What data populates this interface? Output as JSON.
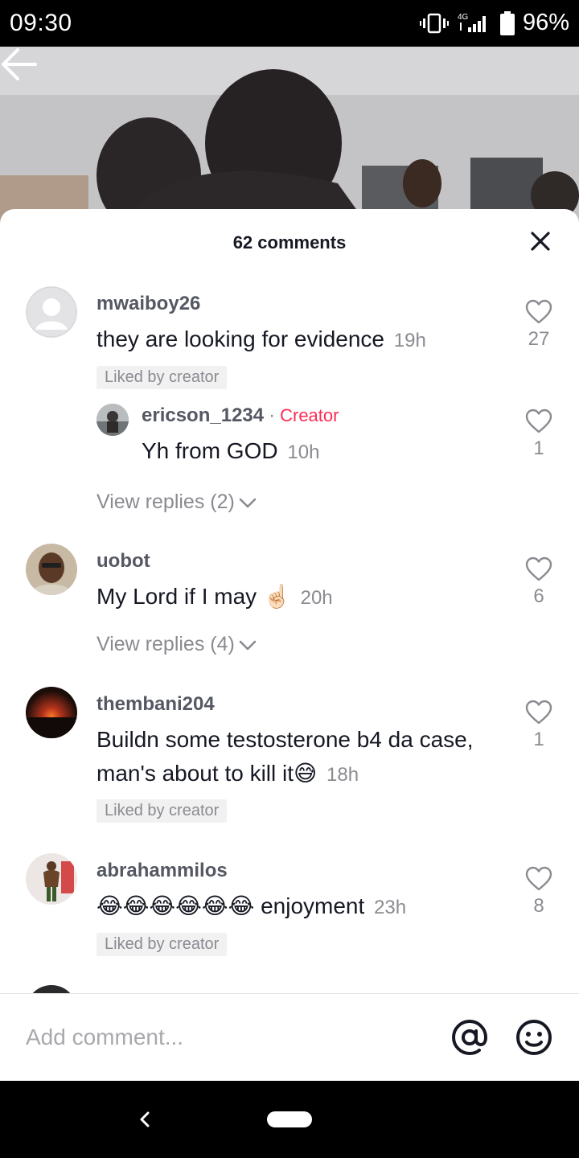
{
  "status_bar": {
    "time": "09:30",
    "network": "4G",
    "battery": "96%"
  },
  "sheet": {
    "title": "62 comments"
  },
  "comments": [
    {
      "username": "mwaiboy26",
      "text": "they are looking for evidence",
      "time": "19h",
      "likes": "27",
      "liked_by_creator": "Liked by creator"
    },
    {
      "username": "ericson_1234",
      "badge": "Creator",
      "text": "Yh from GOD",
      "time": "10h",
      "likes": "1"
    },
    {
      "view_replies": "View replies (2)"
    },
    {
      "username": "uobot",
      "text": "My Lord if I may",
      "emoji": "☝🏻",
      "time": "20h",
      "likes": "6",
      "view_replies": "View replies (4)"
    },
    {
      "username": "thembani204",
      "text_line1": "Buildn some testosterone b4 da case,",
      "text_line2": "man's about to kill it",
      "emoji": "😅",
      "time": "18h",
      "likes": "1",
      "liked_by_creator": "Liked by creator"
    },
    {
      "username": "abrahammilos",
      "emoji": "😂😂😂😂😂😂",
      "text": "enjoyment",
      "time": "23h",
      "likes": "8",
      "liked_by_creator": "Liked by creator"
    }
  ],
  "input": {
    "placeholder": "Add comment..."
  },
  "icons": {
    "back": "back-arrow-icon",
    "close": "close-icon",
    "heart": "heart-outline-icon",
    "chevron": "chevron-down-icon",
    "at": "at-mention-icon",
    "emoji": "emoji-icon"
  },
  "colors": {
    "creator": "#fe2c55",
    "text": "#161823",
    "muted": "#8a8b91"
  }
}
